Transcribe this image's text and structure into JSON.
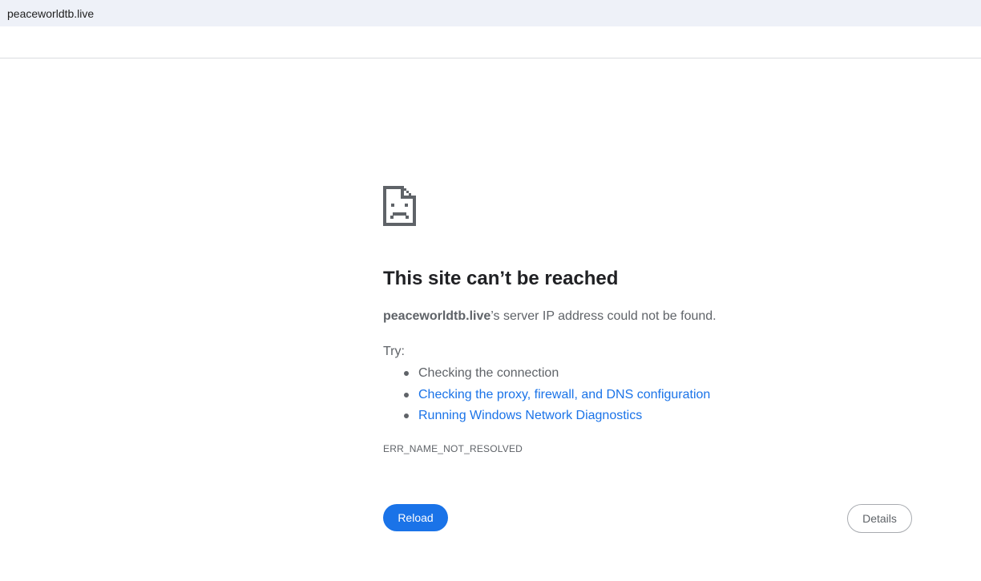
{
  "address_bar": {
    "url": "peaceworldtb.live"
  },
  "error_page": {
    "icon": "sad-page-icon",
    "title": "This site can’t be reached",
    "summary_host": "peaceworldtb.live",
    "summary_rest": "’s server IP address could not be found.",
    "try_label": "Try:",
    "suggestions": [
      "Checking the connection",
      "Checking the proxy, firewall, and DNS configuration",
      "Running Windows Network Diagnostics"
    ],
    "error_code": "ERR_NAME_NOT_RESOLVED",
    "reload_label": "Reload",
    "details_label": "Details"
  },
  "colors": {
    "accent": "#1a73e8",
    "text_secondary": "#5f6368",
    "urlbar_bg": "#eef1f8"
  }
}
